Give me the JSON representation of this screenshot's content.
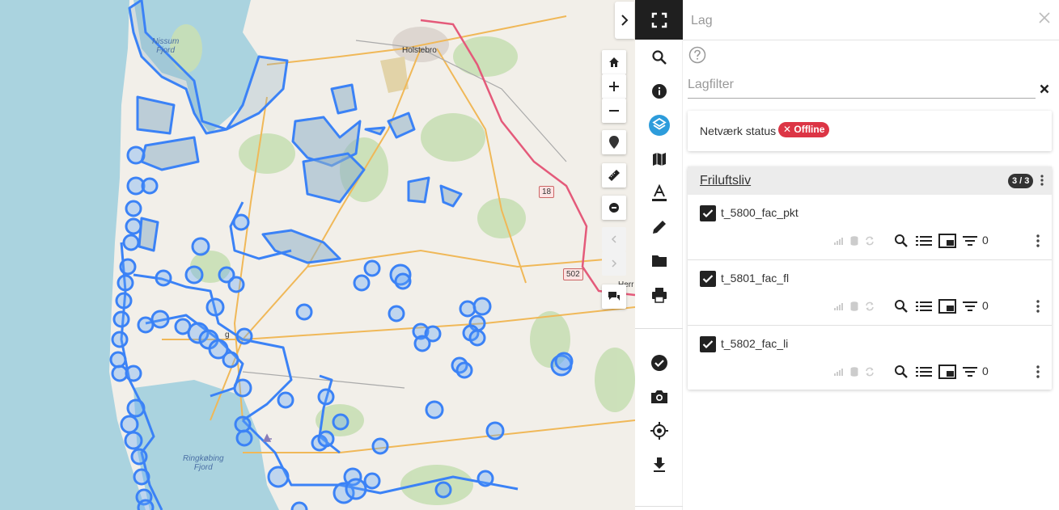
{
  "map": {
    "labels": {
      "city1": "Holstebro",
      "fjord1_line1": "Nissum",
      "fjord1_line2": "Fjord",
      "fjord2_line1": "Ringkøbing",
      "fjord2_line2": "Fjord",
      "town_partial1": "Herr",
      "town_partial2": "g"
    },
    "road_shields": [
      "18",
      "502"
    ],
    "colors": {
      "water": "#aad3df",
      "land": "#f2efe9",
      "overlay": "#3b82f6",
      "fill": "#8fb0c8",
      "forest": "#c8dfb5",
      "road": "#e8a44a",
      "motorway": "#e45a7a"
    }
  },
  "map_controls": {
    "icons": [
      "home-icon",
      "zoom-in-icon",
      "zoom-out-icon",
      "pin-icon",
      "ruler-icon",
      "minus-circle-icon",
      "chevron-left-icon",
      "chevron-right-icon",
      "chat-icon"
    ]
  },
  "toolbar": {
    "icons": [
      "fullscreen-icon",
      "search-icon",
      "info-icon",
      "layers-icon",
      "map-icon",
      "text-icon",
      "pencil-icon",
      "folder-icon",
      "print-icon",
      "check-circle-icon",
      "camera-icon",
      "locate-icon",
      "download-icon"
    ],
    "active": "layers-icon"
  },
  "panel": {
    "title": "Lag",
    "filter_placeholder": "Lagfilter",
    "status": {
      "label": "Netværk status",
      "badge": "Offline",
      "badge_color": "#dc3545"
    },
    "group": {
      "title": "Friluftsliv",
      "count": "3 / 3",
      "layers": [
        {
          "name": "t_5800_fac_pkt",
          "checked": true,
          "filter_count": "0"
        },
        {
          "name": "t_5801_fac_fl",
          "checked": true,
          "filter_count": "0"
        },
        {
          "name": "t_5802_fac_li",
          "checked": true,
          "filter_count": "0"
        }
      ]
    }
  }
}
